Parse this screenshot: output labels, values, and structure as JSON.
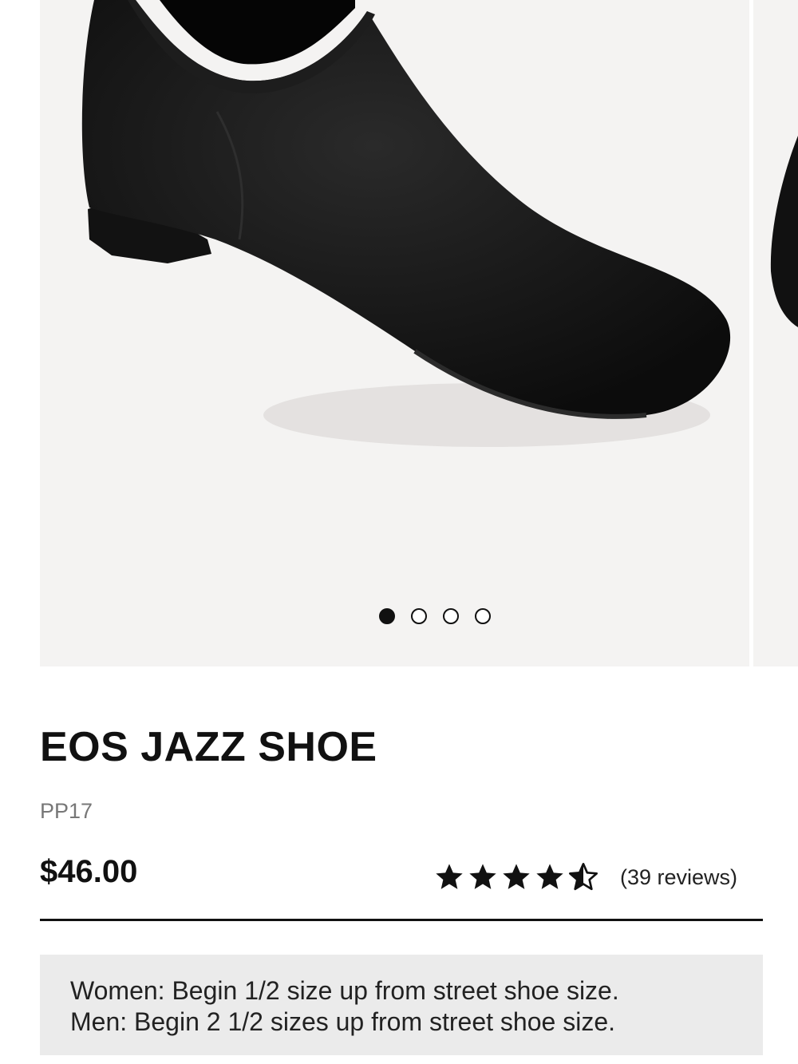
{
  "product": {
    "title": "EOS JAZZ SHOE",
    "sku": "PP17",
    "price": "$46.00",
    "rating": {
      "value": 4.5,
      "max": 5,
      "reviews_label": "(39 reviews)"
    }
  },
  "gallery": {
    "slide_count": 4,
    "active_index": 0,
    "image_desc": "black-jazz-shoe-photo"
  },
  "sizing_note": {
    "women": "Women: Begin 1/2 size up from street shoe size.",
    "men": "Men: Begin 2 1/2 sizes up from street shoe size."
  },
  "colors": {
    "image_bg": "#f4f3f2",
    "note_bg": "#ebebeb",
    "text": "#111111",
    "muted": "#777777"
  }
}
